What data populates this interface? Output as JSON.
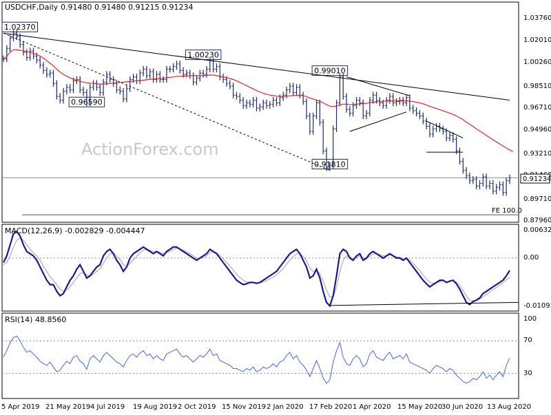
{
  "header": {
    "symbol": "USDCHF,Daily",
    "ohlc": "0.91480 0.91480 0.91215 0.91234"
  },
  "watermark": "ActionForex.com",
  "colors": {
    "price": "#1a2a6c",
    "ma": "#e8202a",
    "macd": "#1a1a8c",
    "signal": "#a0a0a0",
    "rsi": "#4169e1",
    "grid": "#888888",
    "watermark": "#c8c8c8",
    "box_border": "#1a2a6c"
  },
  "chart_data": [
    {
      "id": "price",
      "type": "ohlc",
      "title": "USDCHF,Daily",
      "ylim": [
        0.8796,
        1.0376
      ],
      "y_ticks": [
        "1.03760",
        "1.02010",
        "1.00260",
        "0.98510",
        "0.96710",
        "0.94960",
        "0.93210",
        "0.91460",
        "0.89710",
        "0.87960"
      ],
      "current_value": "0.91234",
      "horizontal_levels": [
        {
          "value": 0.91234
        },
        {
          "value": 0.8838,
          "label": "FE 100.0"
        }
      ],
      "annotations": [
        {
          "label": "1.02370",
          "x": 0,
          "y": 1.0237
        },
        {
          "label": "0.96590",
          "x": 25,
          "y": 0.9659
        },
        {
          "label": "1.00230",
          "x": 60,
          "y": 1.0023
        },
        {
          "label": "0.99010",
          "x": 98,
          "y": 0.9901
        },
        {
          "label": "0.91810",
          "x": 98,
          "y": 0.9181
        }
      ],
      "trendlines": [
        {
          "style": "solid",
          "from": [
            0,
            1.0237
          ],
          "to": [
            152,
            0.9721
          ]
        },
        {
          "style": "dashed",
          "from": [
            0,
            1.0237
          ],
          "to": [
            98,
            0.9181
          ]
        },
        {
          "style": "solid",
          "from": [
            103,
            0.9901
          ],
          "to": [
            122,
            0.9755
          ]
        },
        {
          "style": "solid",
          "from": [
            104,
            0.948
          ],
          "to": [
            121,
            0.963
          ]
        },
        {
          "style": "solid",
          "from": [
            127,
            0.956
          ],
          "to": [
            138,
            0.943
          ]
        },
        {
          "style": "solid",
          "from": [
            127,
            0.932
          ],
          "to": [
            138,
            0.932
          ]
        }
      ],
      "series": [
        {
          "kind": "close",
          "values": [
            1.004,
            1.012,
            1.02,
            1.0237,
            1.021,
            1.015,
            1.009,
            1.005,
            1.01,
            1.006,
            1.003,
            0.999,
            0.995,
            0.992,
            0.993,
            0.985,
            0.975,
            0.972,
            0.979,
            0.982,
            0.98,
            0.987,
            0.988,
            0.98,
            0.978,
            0.97,
            0.982,
            0.985,
            0.982,
            0.978,
            0.986,
            0.992,
            0.988,
            0.985,
            0.98,
            0.979,
            0.973,
            0.981,
            0.988,
            0.99,
            0.987,
            0.993,
            0.996,
            0.991,
            0.994,
            0.988,
            0.992,
            0.988,
            0.988,
            0.996,
            0.996,
            0.998,
            1.0,
            0.995,
            0.992,
            0.993,
            0.991,
            0.986,
            0.989,
            0.993,
            0.992,
            0.996,
            1.0023,
            0.996,
            0.998,
            0.99,
            0.988,
            0.985,
            0.983,
            0.976,
            0.975,
            0.972,
            0.968,
            0.97,
            0.969,
            0.972,
            0.966,
            0.967,
            0.97,
            0.968,
            0.969,
            0.972,
            0.97,
            0.974,
            0.976,
            0.98,
            0.983,
            0.978,
            0.982,
            0.976,
            0.971,
            0.96,
            0.948,
            0.96,
            0.97,
            0.955,
            0.933,
            0.92,
            0.922,
            0.95,
            0.97,
            0.9901,
            0.975,
            0.965,
            0.962,
            0.968,
            0.972,
            0.97,
            0.96,
            0.962,
            0.972,
            0.976,
            0.972,
            0.97,
            0.968,
            0.972,
            0.975,
            0.97,
            0.971,
            0.972,
            0.97,
            0.974,
            0.966,
            0.964,
            0.962,
            0.96,
            0.956,
            0.952,
            0.946,
            0.95,
            0.952,
            0.95,
            0.948,
            0.943,
            0.945,
            0.942,
            0.933,
            0.925,
            0.918,
            0.914,
            0.91,
            0.911,
            0.906,
            0.908,
            0.913,
            0.906,
            0.908,
            0.902,
            0.905,
            0.907,
            0.901,
            0.91,
            0.9123
          ]
        },
        {
          "kind": "moving_average",
          "values": [
            1.003,
            1.006,
            1.009,
            1.011,
            1.011,
            1.0105,
            1.01,
            1.0095,
            1.009,
            1.0082,
            1.0073,
            1.006,
            1.0045,
            1.0025,
            1.0005,
            0.9985,
            0.996,
            0.9938,
            0.992,
            0.9905,
            0.9893,
            0.9883,
            0.9874,
            0.9866,
            0.986,
            0.9855,
            0.9852,
            0.985,
            0.9848,
            0.9846,
            0.9845,
            0.9848,
            0.985,
            0.9852,
            0.9855,
            0.9858,
            0.986,
            0.9862,
            0.9865,
            0.9868,
            0.987,
            0.9872,
            0.9875,
            0.9878,
            0.9881,
            0.9884,
            0.9886,
            0.9888,
            0.989,
            0.9894,
            0.9897,
            0.99,
            0.9903,
            0.9905,
            0.9907,
            0.9909,
            0.991,
            0.991,
            0.991,
            0.991,
            0.991,
            0.9912,
            0.9915,
            0.9914,
            0.991,
            0.9905,
            0.99,
            0.9895,
            0.9888,
            0.988,
            0.987,
            0.9858,
            0.9846,
            0.9833,
            0.982,
            0.9808,
            0.9795,
            0.9785,
            0.9775,
            0.9767,
            0.976,
            0.9756,
            0.9752,
            0.975,
            0.975,
            0.9752,
            0.9754,
            0.9756,
            0.9758,
            0.9758,
            0.9755,
            0.9748,
            0.9738,
            0.973,
            0.9722,
            0.9712,
            0.97,
            0.9686,
            0.9675,
            0.9672,
            0.9675,
            0.9685,
            0.969,
            0.969,
            0.9688,
            0.9688,
            0.969,
            0.9693,
            0.9695,
            0.9697,
            0.9702,
            0.9706,
            0.9708,
            0.971,
            0.9712,
            0.9714,
            0.9716,
            0.9716,
            0.9716,
            0.9716,
            0.9716,
            0.9716,
            0.9714,
            0.971,
            0.9705,
            0.97,
            0.9693,
            0.9684,
            0.9674,
            0.9665,
            0.9657,
            0.9648,
            0.964,
            0.963,
            0.9621,
            0.9611,
            0.96,
            0.9586,
            0.957,
            0.9552,
            0.9535,
            0.9518,
            0.95,
            0.9483,
            0.9467,
            0.945,
            0.9433,
            0.9416,
            0.94,
            0.9384,
            0.9368,
            0.9352,
            0.9338,
            0.9325
          ]
        }
      ]
    },
    {
      "id": "macd",
      "type": "line",
      "label": "MACD(12,26,9) -0.002829 -0.004447",
      "ylim": [
        -0.0115,
        0.007
      ],
      "y_ticks": [
        "0.006321",
        "0.00",
        "-0.010939"
      ],
      "reference_levels": [
        0.0
      ],
      "trendline": {
        "from": [
          98,
          -0.0107
        ],
        "to": [
          152,
          -0.01
        ]
      },
      "series": [
        {
          "kind": "macd",
          "values": [
            -0.001,
            0.0005,
            0.003,
            0.0055,
            0.006,
            0.005,
            0.003,
            0.0015,
            0.001,
            0.0005,
            -0.0005,
            -0.002,
            -0.0035,
            -0.005,
            -0.006,
            -0.006,
            -0.0075,
            -0.0085,
            -0.008,
            -0.0065,
            -0.005,
            -0.004,
            -0.0025,
            -0.0015,
            -0.003,
            -0.0045,
            -0.004,
            -0.003,
            -0.002,
            -0.0015,
            0.0005,
            0.0015,
            0.002,
            0.001,
            -0.0005,
            -0.0015,
            -0.003,
            -0.002,
            0.0,
            0.001,
            0.0015,
            0.002,
            0.0025,
            0.002,
            0.0015,
            0.001,
            0.0015,
            0.001,
            0.0005,
            0.0015,
            0.002,
            0.0025,
            0.0025,
            0.002,
            0.0015,
            0.001,
            0.0005,
            0.0,
            -0.0005,
            0.0,
            0.0005,
            0.001,
            0.002,
            0.0015,
            0.001,
            0.0,
            -0.001,
            -0.002,
            -0.003,
            -0.004,
            -0.005,
            -0.0055,
            -0.006,
            -0.0058,
            -0.0055,
            -0.0055,
            -0.0057,
            -0.0055,
            -0.005,
            -0.0045,
            -0.004,
            -0.0035,
            -0.003,
            -0.002,
            -0.001,
            0.0,
            0.001,
            0.0015,
            0.002,
            0.001,
            -0.0005,
            -0.002,
            -0.0045,
            -0.004,
            -0.0025,
            -0.0045,
            -0.0075,
            -0.01,
            -0.0108,
            -0.0085,
            -0.004,
            0.001,
            0.002,
            0.0015,
            0.0,
            -0.0005,
            0.0005,
            0.001,
            -0.0005,
            0.0,
            0.001,
            0.0015,
            0.001,
            0.0005,
            0.0,
            0.0005,
            0.001,
            0.0005,
            0.0,
            0.0,
            -0.0005,
            0.0,
            -0.001,
            -0.002,
            -0.003,
            -0.004,
            -0.005,
            -0.0058,
            -0.0065,
            -0.006,
            -0.0055,
            -0.005,
            -0.005,
            -0.0055,
            -0.0052,
            -0.005,
            -0.0058,
            -0.007,
            -0.0085,
            -0.01,
            -0.0105,
            -0.0098,
            -0.0095,
            -0.009,
            -0.008,
            -0.0075,
            -0.007,
            -0.0065,
            -0.006,
            -0.0055,
            -0.005,
            -0.004,
            -0.0028
          ]
        },
        {
          "kind": "signal",
          "values": [
            -0.0015,
            -0.001,
            0.0005,
            0.0025,
            0.004,
            0.0045,
            0.004,
            0.003,
            0.002,
            0.0012,
            0.0005,
            -0.0005,
            -0.0018,
            -0.003,
            -0.0042,
            -0.005,
            -0.006,
            -0.007,
            -0.0075,
            -0.0072,
            -0.0065,
            -0.0055,
            -0.0045,
            -0.0035,
            -0.0033,
            -0.0038,
            -0.004,
            -0.0036,
            -0.003,
            -0.0024,
            -0.0012,
            0.0,
            0.001,
            0.0012,
            0.0005,
            -0.0003,
            -0.0015,
            -0.0018,
            -0.0012,
            -0.0004,
            0.0004,
            0.0012,
            0.0018,
            0.002,
            0.0018,
            0.0015,
            0.0015,
            0.0013,
            0.001,
            0.0012,
            0.0015,
            0.002,
            0.0022,
            0.0021,
            0.0018,
            0.0014,
            0.001,
            0.0005,
            0.0,
            -0.0001,
            0.0001,
            0.0005,
            0.0012,
            0.0014,
            0.0012,
            0.0006,
            -0.0002,
            -0.001,
            -0.0018,
            -0.0027,
            -0.0036,
            -0.0044,
            -0.005,
            -0.0054,
            -0.0055,
            -0.0055,
            -0.0056,
            -0.0056,
            -0.0054,
            -0.0051,
            -0.0047,
            -0.0043,
            -0.0038,
            -0.0031,
            -0.0023,
            -0.0014,
            -0.0005,
            0.0003,
            0.001,
            0.001,
            0.0004,
            -0.0006,
            -0.0022,
            -0.003,
            -0.0028,
            -0.0035,
            -0.0052,
            -0.0072,
            -0.0088,
            -0.0087,
            -0.0066,
            -0.003,
            -0.0005,
            0.0005,
            0.0003,
            -0.0001,
            0.0001,
            0.0005,
            0.0001,
            0.0,
            0.0004,
            0.0009,
            0.001,
            0.0008,
            0.0005,
            0.0005,
            0.0007,
            0.0006,
            0.0003,
            0.0002,
            -0.0001,
            -0.0001,
            -0.0005,
            -0.0012,
            -0.002,
            -0.0028,
            -0.0038,
            -0.0047,
            -0.0055,
            -0.0057,
            -0.0056,
            -0.0053,
            -0.0051,
            -0.0053,
            -0.0053,
            -0.0051,
            -0.0054,
            -0.0062,
            -0.0073,
            -0.0086,
            -0.0095,
            -0.0097,
            -0.0096,
            -0.0093,
            -0.0087,
            -0.0082,
            -0.0077,
            -0.0071,
            -0.0066,
            -0.0061,
            -0.0056,
            -0.0049,
            -0.0044
          ]
        }
      ]
    },
    {
      "id": "rsi",
      "type": "line",
      "label": "RSI(14) 48.8560",
      "ylim": [
        0,
        100
      ],
      "y_ticks": [
        "100",
        "70",
        "30"
      ],
      "reference_levels": [
        70,
        30
      ],
      "series": [
        {
          "kind": "rsi",
          "values": [
            50,
            58,
            68,
            74,
            76,
            70,
            62,
            56,
            58,
            54,
            50,
            45,
            42,
            40,
            44,
            38,
            32,
            34,
            40,
            45,
            42,
            50,
            52,
            45,
            42,
            35,
            48,
            52,
            48,
            44,
            52,
            56,
            52,
            48,
            44,
            42,
            38,
            46,
            52,
            54,
            50,
            55,
            58,
            52,
            54,
            48,
            52,
            48,
            46,
            54,
            56,
            58,
            60,
            54,
            50,
            52,
            48,
            44,
            48,
            52,
            50,
            54,
            60,
            52,
            54,
            46,
            44,
            42,
            40,
            36,
            36,
            34,
            32,
            36,
            34,
            38,
            32,
            34,
            38,
            36,
            38,
            42,
            38,
            44,
            46,
            52,
            56,
            48,
            52,
            44,
            40,
            34,
            26,
            36,
            46,
            36,
            24,
            18,
            22,
            44,
            58,
            68,
            50,
            42,
            40,
            48,
            52,
            48,
            38,
            42,
            54,
            58,
            50,
            48,
            46,
            52,
            56,
            48,
            50,
            52,
            48,
            54,
            44,
            42,
            40,
            38,
            36,
            34,
            30,
            36,
            40,
            38,
            36,
            32,
            36,
            34,
            28,
            24,
            20,
            18,
            20,
            24,
            22,
            26,
            32,
            24,
            28,
            22,
            28,
            32,
            26,
            40,
            49
          ]
        }
      ]
    }
  ],
  "x_axis": {
    "tick_labels": [
      "5 Apr 2019",
      "21 May 2019",
      "4 Jul 2019",
      "19 Aug 2019",
      "2 Oct 2019",
      "15 Nov 2019",
      "2 Jan 2020",
      "17 Feb 2020",
      "1 Apr 2020",
      "15 May 2020",
      "30 Jun 2020",
      "13 Aug 2020"
    ]
  }
}
